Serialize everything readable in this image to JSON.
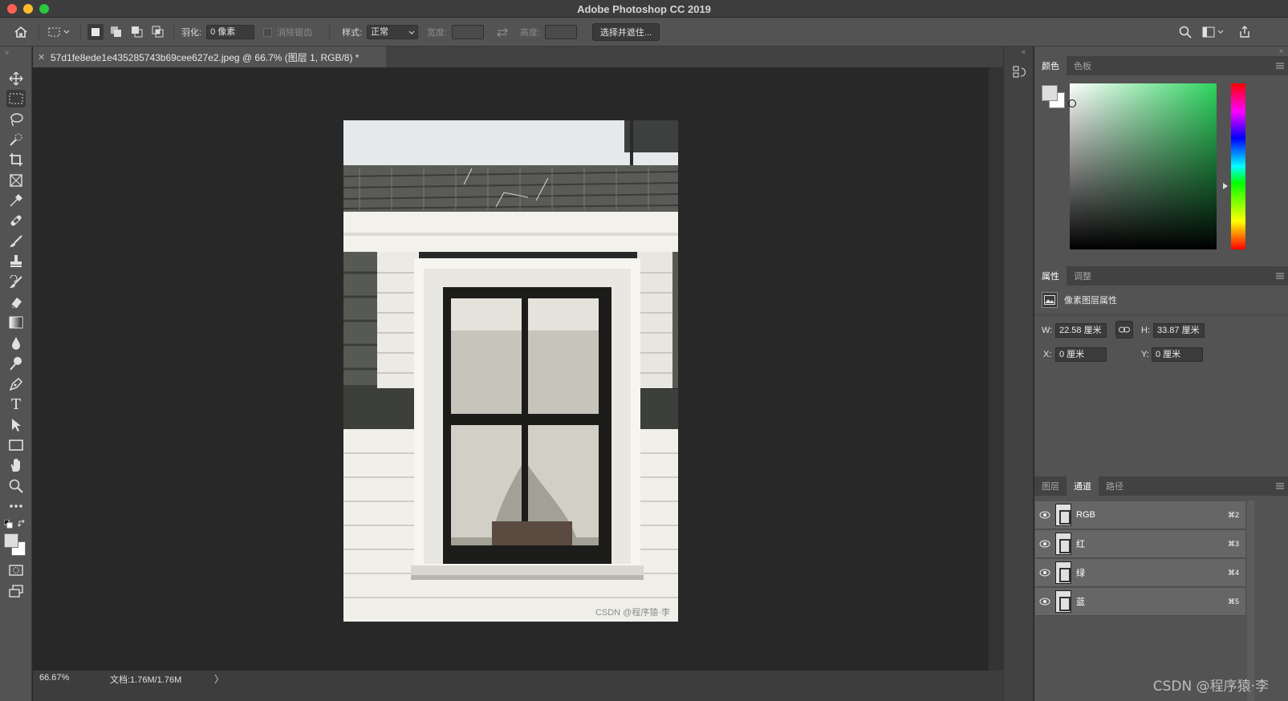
{
  "window": {
    "title": "Adobe Photoshop CC 2019"
  },
  "options_bar": {
    "feather_label": "羽化:",
    "feather_value": "0 像素",
    "antialias_label": "消除锯齿",
    "style_label": "样式:",
    "style_value": "正常",
    "width_label": "宽度:",
    "height_label": "高度:",
    "select_mask_button": "选择并遮住..."
  },
  "document": {
    "tab_title": "57d1fe8ede1e435285743b69cee627e2.jpeg @ 66.7% (图层 1, RGB/8) *",
    "image_watermark": "CSDN @程序猿·李"
  },
  "status_bar": {
    "zoom": "66.67%",
    "doc_size": "文档:1.76M/1.76M",
    "arrow": "〉"
  },
  "color_panel": {
    "tabs": [
      "颜色",
      "色板"
    ],
    "active_tab": 0,
    "foreground_color": "#dedede",
    "background_color": "#ffffff",
    "hue_color": "#2ed45f"
  },
  "properties_panel": {
    "tabs": [
      "属性",
      "调整"
    ],
    "active_tab": 0,
    "header": "像素图层属性",
    "w_label": "W:",
    "w_value": "22.58 厘米",
    "h_label": "H:",
    "h_value": "33.87 厘米",
    "x_label": "X:",
    "x_value": "0 厘米",
    "y_label": "Y:",
    "y_value": "0 厘米"
  },
  "channels_panel": {
    "tabs": [
      "图层",
      "通道",
      "路径"
    ],
    "active_tab": 1,
    "channels": [
      {
        "name": "RGB",
        "shortcut": "⌘2"
      },
      {
        "name": "红",
        "shortcut": "⌘3"
      },
      {
        "name": "绿",
        "shortcut": "⌘4"
      },
      {
        "name": "蓝",
        "shortcut": "⌘5"
      }
    ]
  },
  "page_watermark": "CSDN @程序猿·李",
  "tools": [
    "move-tool",
    "marquee-tool",
    "lasso-tool",
    "quick-selection-tool",
    "crop-tool",
    "frame-tool",
    "eyedropper-tool",
    "healing-brush-tool",
    "brush-tool",
    "clone-stamp-tool",
    "history-brush-tool",
    "eraser-tool",
    "gradient-tool",
    "blur-tool",
    "dodge-tool",
    "pen-tool",
    "type-tool",
    "path-selection-tool",
    "rectangle-tool",
    "hand-tool",
    "zoom-tool",
    "more-tools"
  ],
  "type_tool_glyph": "T"
}
